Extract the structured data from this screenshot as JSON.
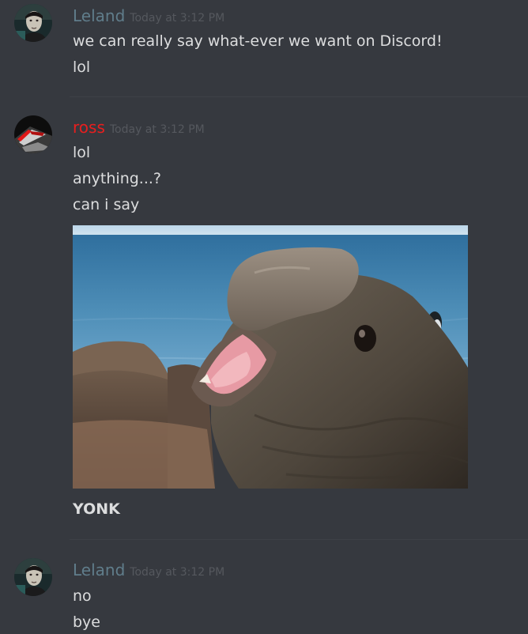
{
  "messages": [
    {
      "author": "Leland",
      "author_color": "#607d8b",
      "timestamp": "Today at 3:12 PM",
      "lines": [
        "we can really say what-ever we want on Discord!",
        "lol"
      ]
    },
    {
      "author": "ross",
      "author_color": "#e91e1e",
      "timestamp": "Today at 3:12 PM",
      "lines": [
        "lol",
        "anything...?",
        "can i say"
      ],
      "attachment": {
        "caption": "YONK"
      }
    },
    {
      "author": "Leland",
      "author_color": "#607d8b",
      "timestamp": "Today at 3:12 PM",
      "lines": [
        "no",
        "bye"
      ]
    }
  ]
}
